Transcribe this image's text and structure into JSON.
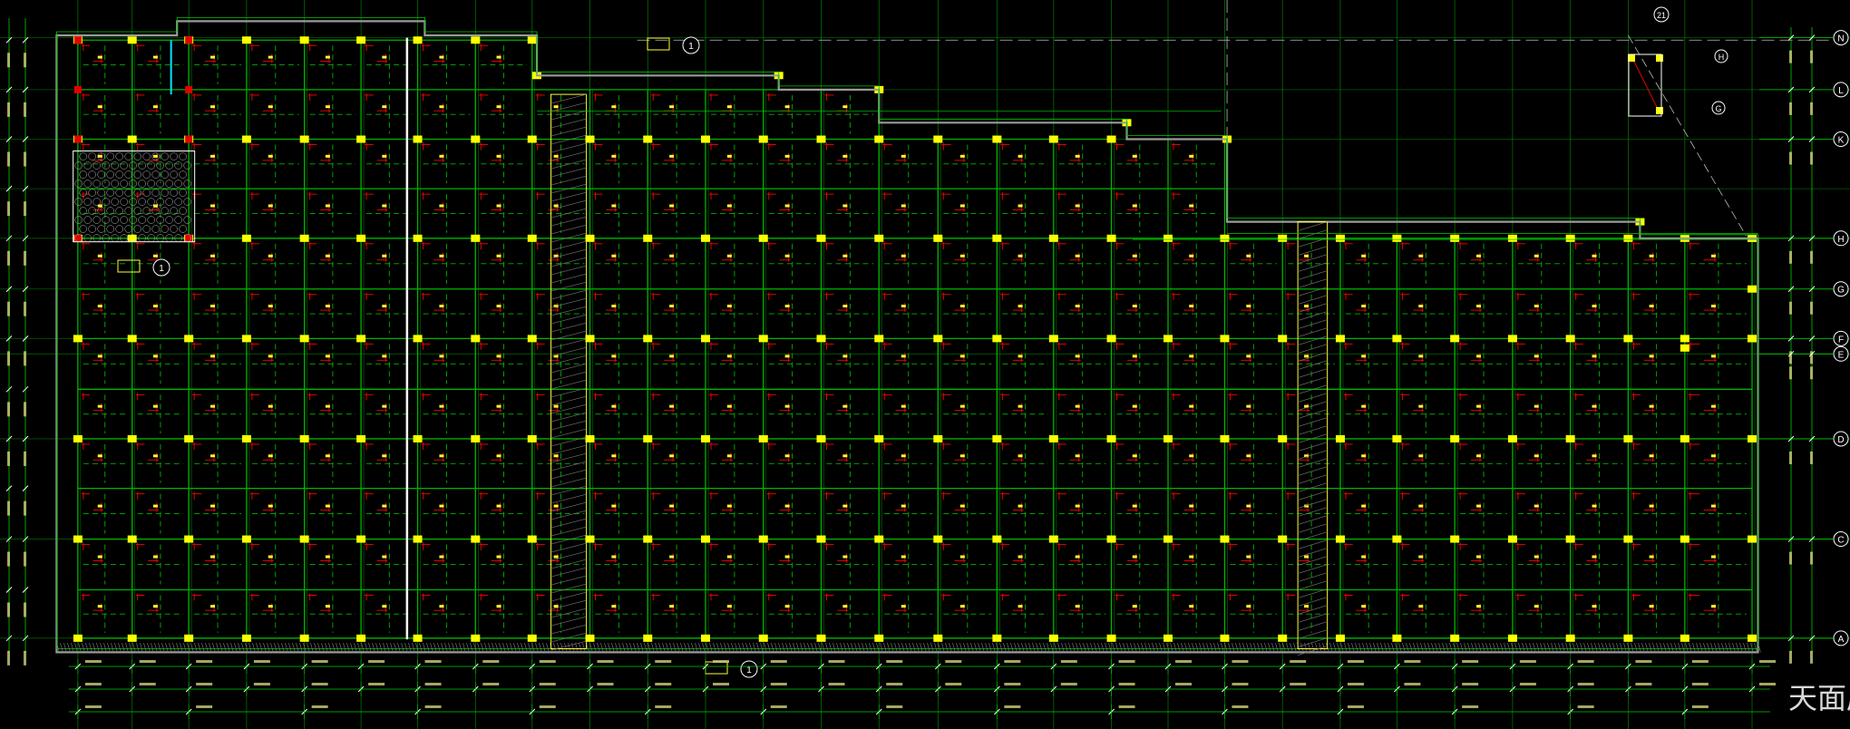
{
  "drawing": {
    "title_stamp": "天面层",
    "colors": {
      "background": "#000000",
      "grid_line": "#00cc00",
      "column": "#ffff00",
      "rebar_red": "#e60000",
      "beam_green": "#00b300",
      "label_yellow": "#ffff33",
      "parapet": "#9a9a9a",
      "white": "#ffffff",
      "cyan": "#00e5ff"
    },
    "row_axis_labels": [
      "N",
      "L",
      "K",
      "H",
      "G",
      "F",
      "E",
      "D",
      "C",
      "A"
    ],
    "upper_right_axis_labels": [
      "H",
      "G"
    ],
    "callouts": [
      "1",
      "1",
      "1",
      "21"
    ]
  }
}
